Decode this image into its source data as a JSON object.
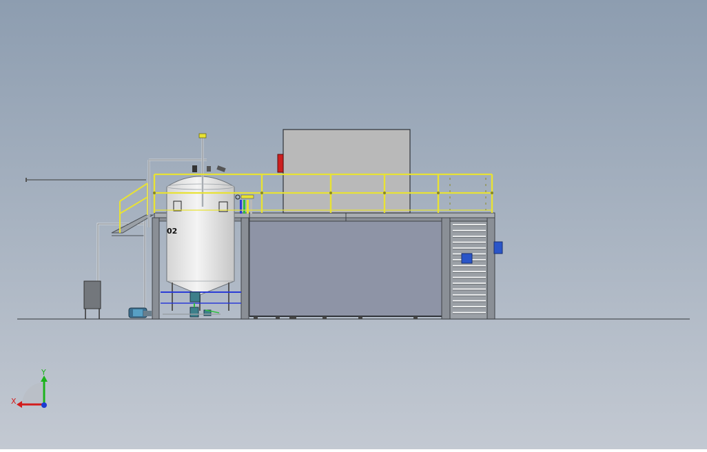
{
  "viewport": {
    "background_top": "#8d9db0",
    "background_bottom": "#c3c9d2"
  },
  "colors": {
    "rail_yellow": "#e8e234",
    "steel_gray": "#8a8f96",
    "panel_gray": "#8e94a6",
    "enclosure_gray": "#b9b9b9",
    "tank_white": "#eeeeee",
    "pipe_blue": "#2a3bd6",
    "accent_red": "#cc1f1f",
    "box_blue": "#2a55c8",
    "dark_box": "#6f7378"
  },
  "labels": {
    "tank_tag": "02"
  },
  "triad": {
    "x_label": "X",
    "y_label": "Y",
    "x_color": "#d21c1c",
    "y_color": "#1cb31c",
    "z_color": "#1c3bd2"
  }
}
